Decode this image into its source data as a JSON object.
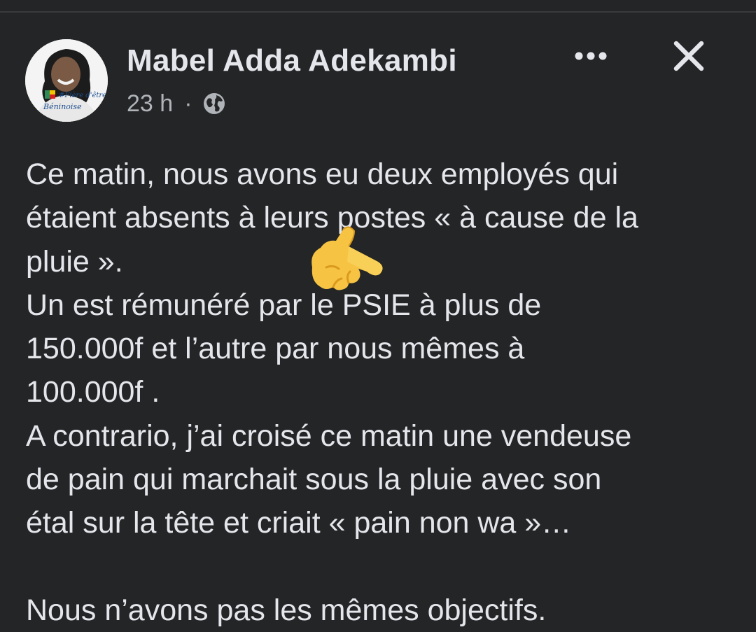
{
  "post": {
    "author": "Mabel Adda Adekambi",
    "time": "23 h",
    "separator": "·",
    "privacy_icon": "globe-icon",
    "avatar_caption_1": "#Fière d'être",
    "avatar_caption_2": "Béninoise"
  },
  "header_actions": {
    "more_icon": "more-icon",
    "close_icon": "close-icon"
  },
  "body": {
    "lines": [
      "Ce matin, nous avons eu deux employés qui",
      "étaient absents à leurs postes « à cause de la",
      "pluie ».",
      "Un est rémunéré par le PSIE à plus de",
      "150.000f et l’autre par nous mêmes à",
      "100.000f .",
      "A contrario, j’ai croisé ce matin une vendeuse",
      "de pain qui marchait sous la pluie avec son",
      "étal sur la tête et criait « pain non wa »…",
      "",
      "Nous n’avons pas les mêmes objectifs."
    ],
    "emoji": "pointing-right-hand-emoji"
  },
  "colors": {
    "background": "#242526",
    "primary_text": "#e4e6eb",
    "secondary_text": "#b0b3b8",
    "divider": "#3a3b3c",
    "emoji_yellow": "#f6c343"
  }
}
